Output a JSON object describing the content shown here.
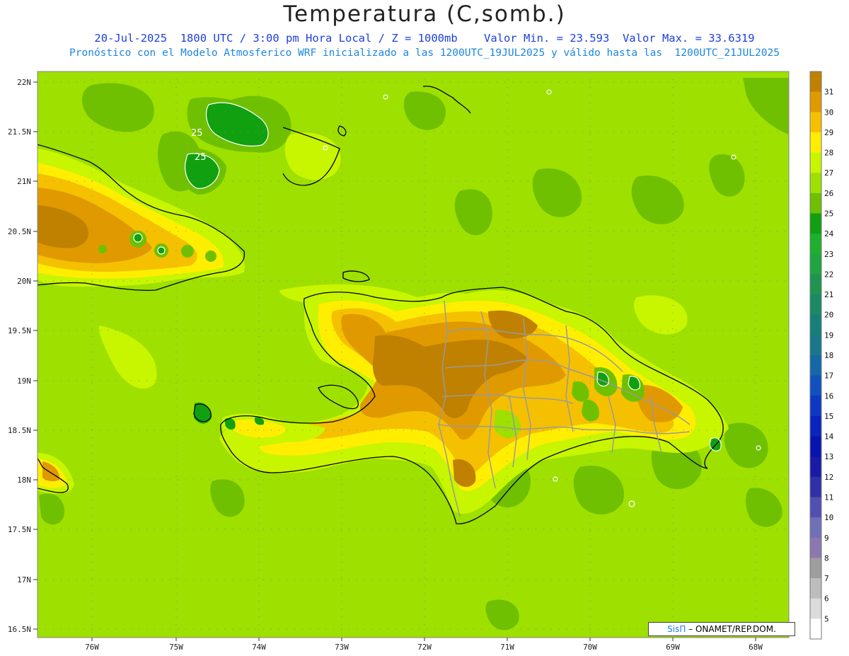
{
  "header": {
    "title": "Temperatura (C,somb.)",
    "subtitle_line1": "20-Jul-2025  1800 UTC / 3:00 pm Hora Local / Z = 1000mb    Valor Min. = 23.593  Valor Max. = 33.6319",
    "subtitle_line2": "Pronóstico con el Modelo Atmosferico WRF inicializado a las 1200UTC_19JUL2025 y válido hasta las  1200UTC_21JUL2025"
  },
  "axes": {
    "lat_ticks": [
      "22N",
      "21.5N",
      "21N",
      "20.5N",
      "20N",
      "19.5N",
      "19N",
      "18.5N",
      "18N",
      "17.5N",
      "17N",
      "16.5N"
    ],
    "lon_ticks": [
      "76W",
      "75W",
      "74W",
      "73W",
      "72W",
      "71W",
      "70W",
      "69W",
      "68W"
    ]
  },
  "colorbar": {
    "labels": [
      "31",
      "30",
      "29",
      "28",
      "27",
      "26",
      "25",
      "24",
      "23",
      "22",
      "21",
      "20",
      "19",
      "18",
      "17",
      "16",
      "15",
      "14",
      "13",
      "12",
      "11",
      "10",
      "9",
      "8",
      "7",
      "6",
      "5"
    ],
    "colors": [
      "#c08000",
      "#e09a00",
      "#f5c000",
      "#ffee00",
      "#c8f500",
      "#9ee000",
      "#6fc000",
      "#10a010",
      "#1cb02c",
      "#20a640",
      "#1e9450",
      "#1a8a64",
      "#168078",
      "#16788a",
      "#1468a8",
      "#1050c0",
      "#0c38c4",
      "#0a24c0",
      "#0814b0",
      "#1a1aa8",
      "#3030a8",
      "#5050b0",
      "#7070b8",
      "#8a78b0",
      "#9e9e9e",
      "#bdbdbd",
      "#dcdcdc",
      "#ffffff"
    ]
  },
  "contour_labels": [
    "25",
    "25"
  ],
  "credit": {
    "logo": "SisΠ",
    "text": "– ONAMET/REP.DOM."
  }
}
